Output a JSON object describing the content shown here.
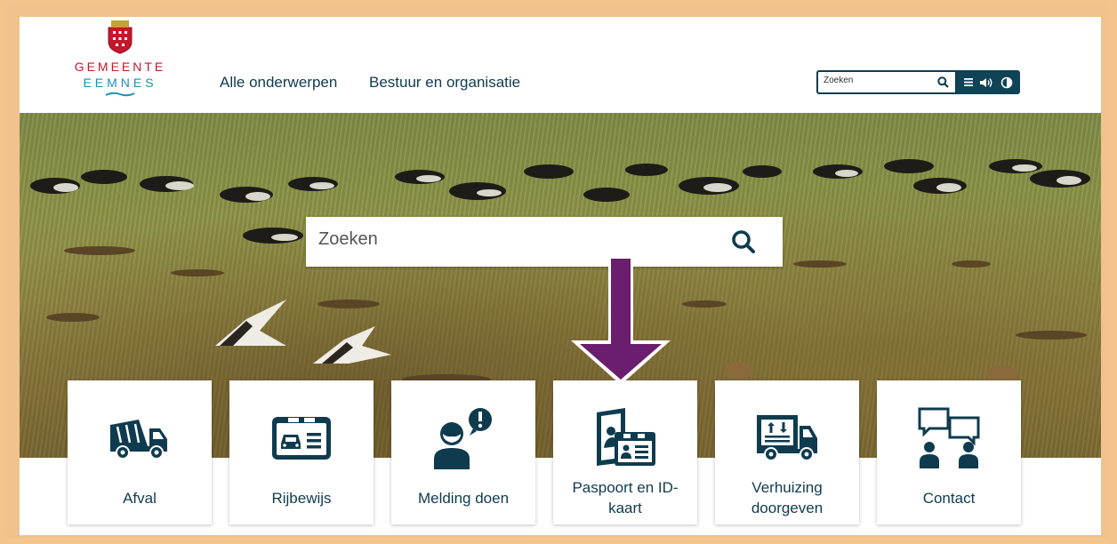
{
  "header": {
    "logo": {
      "line1": "GEMEENTE",
      "line2": "EEMNES",
      "icon": "crest-icon"
    },
    "nav": [
      "Alle onderwerpen",
      "Bestuur en organisatie"
    ],
    "search": {
      "placeholder": "Zoeken",
      "icon": "search-icon"
    },
    "tools": [
      "menu-icon",
      "speaker-icon",
      "contrast-icon"
    ]
  },
  "hero": {
    "search": {
      "placeholder": "Zoeken",
      "icon": "search-icon"
    },
    "arrow": {
      "icon": "arrow-down-icon",
      "color": "#6b1d6e"
    }
  },
  "tiles": [
    {
      "label": "Afval",
      "icon": "garbage-truck-icon"
    },
    {
      "label": "Rijbewijs",
      "icon": "driving-license-icon"
    },
    {
      "label": "Melding doen",
      "icon": "report-person-icon"
    },
    {
      "label": "Paspoort en ID-kaart",
      "line1": "Paspoort en ID-",
      "line2": "kaart",
      "icon": "passport-id-icon"
    },
    {
      "label": "Verhuizing doorgeven",
      "line1": "Verhuizing",
      "line2": "doorgeven",
      "icon": "moving-truck-icon"
    },
    {
      "label": "Contact",
      "icon": "contact-chat-icon"
    }
  ],
  "colors": {
    "primary": "#0f3b4f",
    "accent_red": "#c4172c",
    "accent_blue": "#1a8fb8",
    "arrow": "#6b1d6e",
    "frame": "#f3c48c"
  }
}
